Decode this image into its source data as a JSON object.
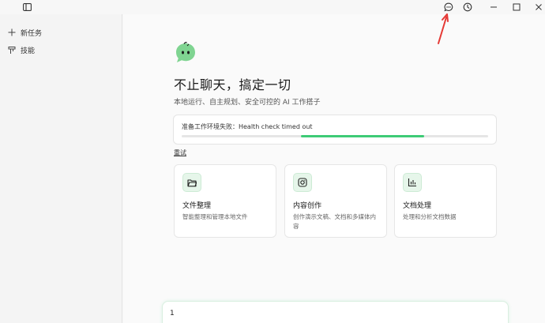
{
  "titlebar": {
    "icons": [
      "sidebar-toggle-icon",
      "chat-bubble-icon",
      "clock-icon",
      "minimize-icon",
      "maximize-icon",
      "close-icon"
    ]
  },
  "sidebar": {
    "items": [
      {
        "label": "新任务",
        "icon": "plus-icon"
      },
      {
        "label": "技能",
        "icon": "tool-icon"
      }
    ]
  },
  "hero": {
    "title": "不止聊天，搞定一切",
    "subtitle": "本地运行、自主规划、安全可控的 AI 工作搭子"
  },
  "status": {
    "text": "准备工作环境失败：Health check timed out",
    "progress_start": 0.39,
    "progress_end": 0.79,
    "retry_label": "重试"
  },
  "cards": [
    {
      "title": "文件整理",
      "desc": "智能整理和管理本地文件",
      "icon": "folder-icon"
    },
    {
      "title": "内容创作",
      "desc": "创作演示文稿、文档和多媒体内容",
      "icon": "instagram-icon"
    },
    {
      "title": "文档处理",
      "desc": "处理和分析文档数据",
      "icon": "bar-chart-icon"
    }
  ],
  "chat": {
    "value": "1"
  },
  "colors": {
    "accent": "#3ecb76",
    "arrow": "#e53935"
  }
}
